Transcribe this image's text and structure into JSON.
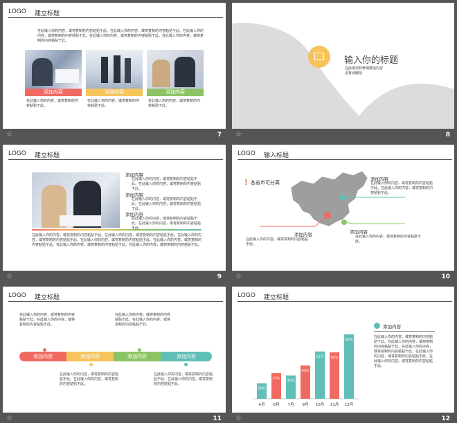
{
  "logo": "LOGO",
  "s7": {
    "title": "建立标题",
    "intro": "在此输入你的内容，或将复制的内容粘贴于此。在此输入你的内容，或将复制的内容粘贴于此。在此输入你的内容，或将复制的内容粘贴于此。在此输入你的内容，或将复制的内容粘贴于此。在此输入你的内容，或将复制的内容粘贴于此。",
    "cards": [
      {
        "label": "添加内容",
        "color": "#f06a62",
        "text": "在此输入你的内容，或将复制的内容粘贴于此。"
      },
      {
        "label": "添加内容",
        "color": "#f7c45c",
        "text": "在此输入你的内容，或将复制的内容粘贴于此。"
      },
      {
        "label": "添加内容",
        "color": "#8cc465",
        "text": "在此输入你的内容，或将复制的内容粘贴于此。"
      }
    ],
    "num": "7"
  },
  "s8": {
    "title": "输入你的标题",
    "sub1": "在此添加背景或概括内容",
    "sub2": "没有请删除",
    "num": "8"
  },
  "s9": {
    "title": "建立标题",
    "items": [
      {
        "heading": "添加内容",
        "text": "在此输入你的内容，或将复制的内容粘贴于此。在此输入你的内容，或将复制的内容粘贴于此。"
      },
      {
        "heading": "添加内容",
        "text": "在此输入你的内容，或将复制的内容粘贴于此。在此输入你的内容，或将复制的内容粘贴于此。"
      },
      {
        "heading": "添加内容",
        "text": "在此输入你的内容，或将复制的内容粘贴于此。在此输入你的内容，或将复制的内容粘贴于此。"
      }
    ],
    "body": "在此输入你的内容，或将复制的内容粘贴于此。在此输入你的内容，或将复制的内容粘贴于此。在此输入你的内容，或将复制的内容粘贴于此。在此输入你的内容，或将复制的内容粘贴于此。在此输入你的内容，或将复制的内容粘贴于此。在此输入你的内容，或将复制的内容粘贴于此。在此输入你的内容，或将复制的内容粘贴于此。",
    "num": "9"
  },
  "s10": {
    "title": "输入标题",
    "map_label": "各省市可分离",
    "right_heading": "添加内容",
    "right_text": "在此输入你的内容，或将复制的内容粘贴于此。在此输入你的内容，或将复制的内容粘贴于此。",
    "left_heading": "添加内容",
    "left_text": "在此输入你的内容，或将复制的内容粘贴于此。",
    "br_heading": "添加内容",
    "br_text": "在此输入你的内容，或将复制的内容粘贴于此。",
    "num": "10"
  },
  "s11": {
    "title": "建立标题",
    "top_left": "在此输入你的内容，或将复制的内容粘贴于此。在此输入你的内容，或将复制的内容粘贴于此。",
    "top_right": "在此输入你的内容，或将复制的内容粘贴于此。在此输入你的内容，或将复制的内容粘贴于此。",
    "bottom_left": "在此输入你的内容，或将复制的内容粘贴于此。在此输入你的内容，或将复制的内容粘贴于此。",
    "bottom_right": "在此输入你的内容，或将复制的内容粘贴于此。在此输入你的内容，或将复制的内容粘贴于此。",
    "steps": [
      {
        "label": "添加内容",
        "color": "#f06a62"
      },
      {
        "label": "添加内容",
        "color": "#f7c45c"
      },
      {
        "label": "添加内容",
        "color": "#8cc465"
      },
      {
        "label": "添加内容",
        "color": "#5fbfb6"
      }
    ],
    "num": "11"
  },
  "s12": {
    "title": "建立标题",
    "legend": "添加内容",
    "text": "在此输入你的内容，或将复制的内容粘贴于此。在此输入你的内容，或将复制的内容粘贴于此。在此输入你的内容，或将复制的内容粘贴于此。在此输入你的内容，或将复制的内容粘贴于此。在此输入你的内容，或将复制的内容粘贴于此。",
    "num": "12"
  },
  "chart_data": {
    "type": "bar",
    "categories": [
      "4月",
      "6月",
      "7月",
      "9月",
      "10月",
      "11月",
      "12月"
    ],
    "values": [
      20,
      33,
      30,
      43,
      61,
      60,
      83
    ],
    "labels": [
      "20%",
      "33%",
      "30%",
      "43%",
      "61%",
      "60%",
      "83%"
    ],
    "colors": [
      "#5fbfb6",
      "#f06a62",
      "#5fbfb6",
      "#f06a62",
      "#5fbfb6",
      "#f06a62",
      "#5fbfb6"
    ],
    "ylim": [
      0,
      100
    ]
  }
}
